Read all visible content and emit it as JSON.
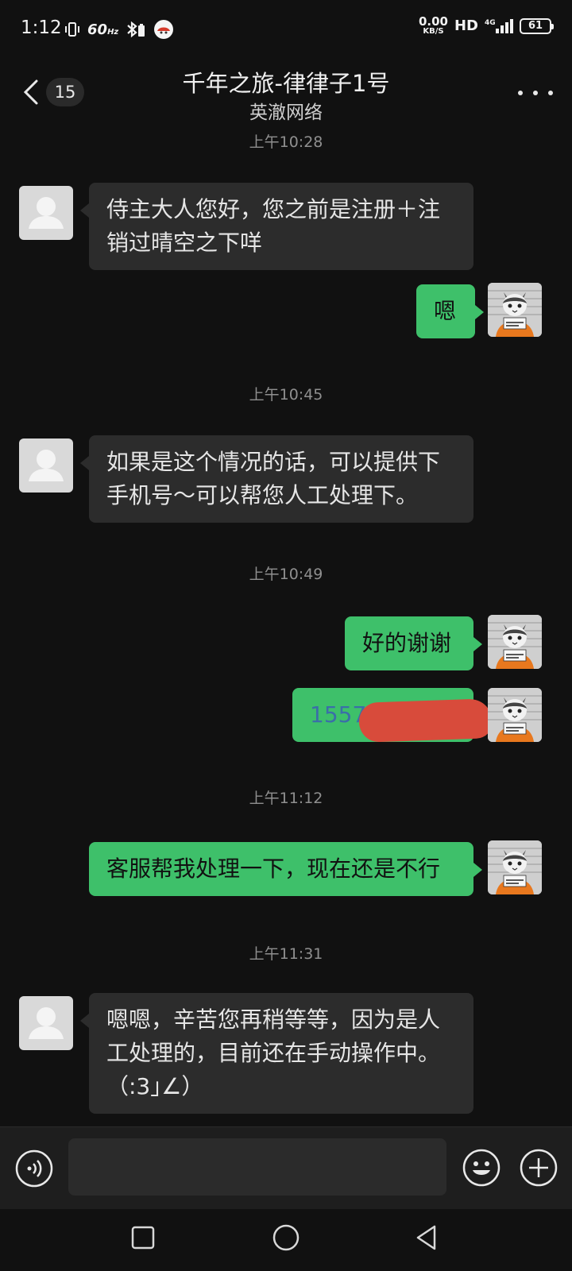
{
  "status_bar": {
    "time": "1:12",
    "refresh_rate": "60",
    "refresh_unit": "Hz",
    "net_speed": "0.00",
    "net_unit": "KB/S",
    "hd": "HD",
    "network": "4G",
    "battery": "61"
  },
  "header": {
    "back_count": "15",
    "title": "千年之旅-律律子1号",
    "subtitle": "英澈网络"
  },
  "messages": [
    {
      "type": "time",
      "text": "上午10:28"
    },
    {
      "type": "in",
      "text": "侍主大人您好，您之前是注册＋注销过晴空之下咩"
    },
    {
      "type": "out",
      "text": "嗯"
    },
    {
      "type": "time",
      "text": "上午10:45"
    },
    {
      "type": "in",
      "text": "如果是这个情况的话，可以提供下手机号～可以帮您人工处理下。"
    },
    {
      "type": "time",
      "text": "上午10:49"
    },
    {
      "type": "out",
      "text": "好的谢谢"
    },
    {
      "type": "out",
      "text": "1557",
      "redacted": true
    },
    {
      "type": "time",
      "text": "上午11:12"
    },
    {
      "type": "out",
      "text": "客服帮我处理一下，现在还是不行"
    },
    {
      "type": "time",
      "text": "上午11:31"
    },
    {
      "type": "in",
      "text": "嗯嗯，辛苦您再稍等等，因为是人工处理的，目前还在手动操作中。（:3｣∠）"
    }
  ],
  "input": {
    "placeholder": ""
  },
  "colors": {
    "background": "#111111",
    "incoming_bubble": "#2c2c2c",
    "outgoing_bubble": "#3ec06a",
    "phone_link": "#3a6fa8",
    "redaction": "#d84b3b"
  },
  "icons": {
    "avatar_in": "default-user-avatar-icon",
    "avatar_out": "cat-mugshot-avatar"
  }
}
